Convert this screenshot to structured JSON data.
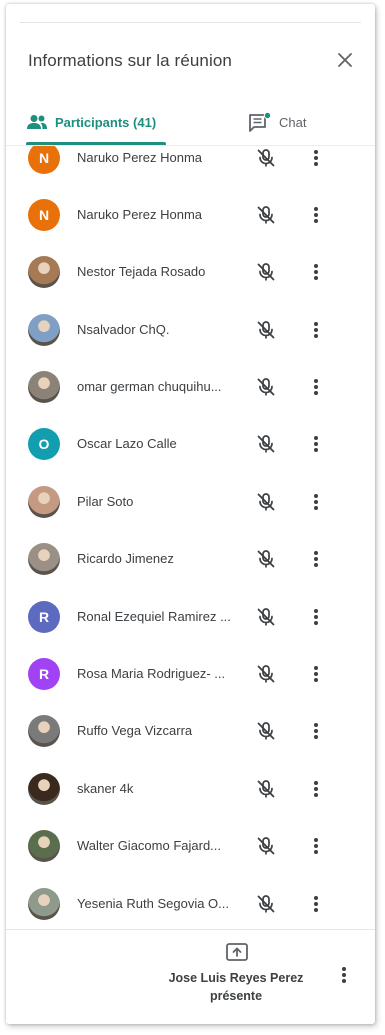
{
  "header": {
    "title": "Informations sur la réunion",
    "close_icon": "close-icon"
  },
  "tabs": {
    "participants_label": "Participants (41)",
    "chat_label": "Chat",
    "accent": "#1e8e7e"
  },
  "participants": [
    {
      "name": "Naruko Perez Honma",
      "initial": "N",
      "color": "#e8710a",
      "photo": false
    },
    {
      "name": "Naruko Perez Honma",
      "initial": "N",
      "color": "#e8710a",
      "photo": false
    },
    {
      "name": "Nestor Tejada Rosado",
      "initial": "",
      "color": "#a57a55",
      "photo": true
    },
    {
      "name": "Nsalvador ChQ.",
      "initial": "",
      "color": "#7fa0c4",
      "photo": true
    },
    {
      "name": "omar german chuquihu...",
      "initial": "",
      "color": "#8b8278",
      "photo": true
    },
    {
      "name": "Oscar Lazo Calle",
      "initial": "O",
      "color": "#129eaf",
      "photo": false
    },
    {
      "name": "Pilar Soto",
      "initial": "",
      "color": "#c49a82",
      "photo": true
    },
    {
      "name": "Ricardo Jimenez",
      "initial": "",
      "color": "#9a9086",
      "photo": true
    },
    {
      "name": "Ronal Ezequiel Ramirez ...",
      "initial": "R",
      "color": "#5c6bc0",
      "photo": false
    },
    {
      "name": "Rosa Maria Rodriguez- ...",
      "initial": "R",
      "color": "#a142f4",
      "photo": false
    },
    {
      "name": "Ruffo Vega Vizcarra",
      "initial": "",
      "color": "#7a7a7a",
      "photo": true
    },
    {
      "name": "skaner 4k",
      "initial": "",
      "color": "#3a2a1e",
      "photo": true
    },
    {
      "name": "Walter Giacomo Fajard...",
      "initial": "",
      "color": "#5a6e4e",
      "photo": true
    },
    {
      "name": "Yesenia Ruth Segovia O...",
      "initial": "",
      "color": "#8e9a8c",
      "photo": true
    }
  ],
  "footer": {
    "presenter_line1": "Jose Luis Reyes Perez",
    "presenter_line2": "présente",
    "present_icon": "present-to-all-icon"
  }
}
